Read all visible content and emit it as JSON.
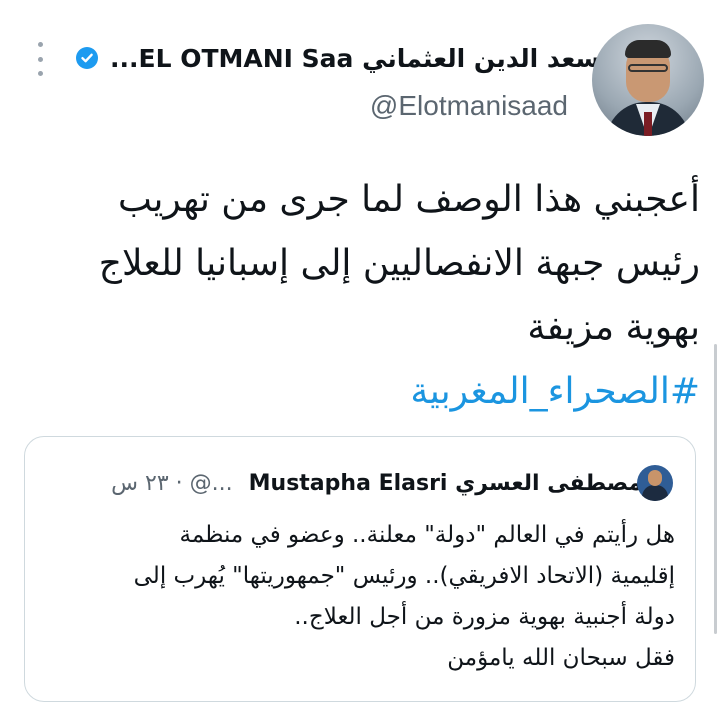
{
  "tweet": {
    "display_name": "سعد الدين العثماني EL OTMANI Saa...",
    "handle": "@Elotmanisaad",
    "text_lines": [
      "أعجبني هذا الوصف لما جرى من تهريب",
      "رئيس جبهة الانفصاليين إلى إسبانيا للعلاج",
      "بهوية مزيفة"
    ],
    "hashtag": "#الصحراء_المغربية"
  },
  "quoted": {
    "name": "المصطفى العسري Mustapha Elasri",
    "meta": "...@ · ٢٣ س",
    "text_lines": [
      "هل رأيتم في العالم \"دولة\" معلنة.. وعضو في منظمة",
      "إقليمية (الاتحاد الافريقي).. ورئيس \"جمهوريتها\" يُهرب إلى",
      "دولة أجنبية بهوية مزورة من أجل العلاج..",
      "فقل سبحان الله يامؤمن"
    ]
  },
  "icons": {
    "verified": "verified-badge-icon",
    "more": "more-options-icon"
  },
  "colors": {
    "link": "#1b95e0",
    "verified": "#1d9bf0",
    "secondary_text": "#5b6670",
    "border": "#cfd9de"
  }
}
